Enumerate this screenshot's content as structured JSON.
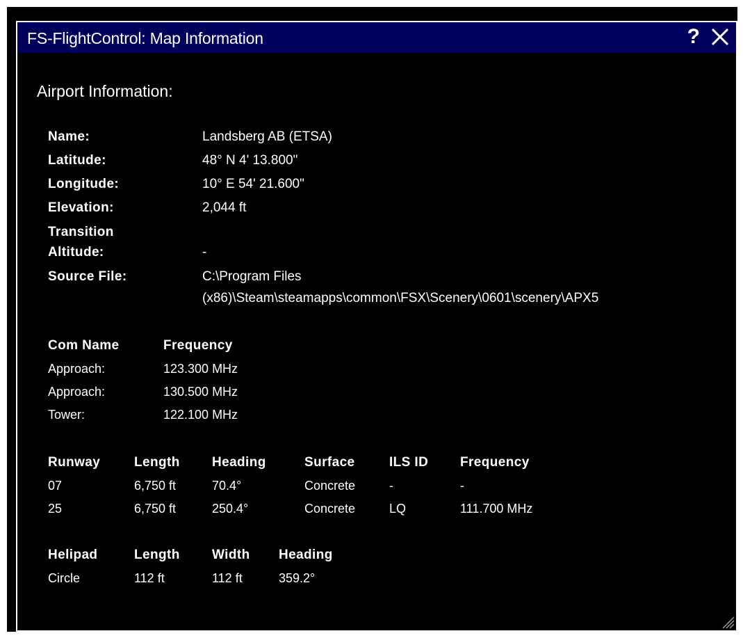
{
  "window": {
    "title": "FS-FlightControl: Map Information",
    "help_label": "?"
  },
  "section_title": "Airport Information:",
  "airport": {
    "name_label": "Name:",
    "name_value": "Landsberg AB (ETSA)",
    "latitude_label": "Latitude:",
    "latitude_value": "48° N 4' 13.800\"",
    "longitude_label": "Longitude:",
    "longitude_value": "10° E 54' 21.600\"",
    "elevation_label": "Elevation:",
    "elevation_value": "2,044 ft",
    "transition_label_1": "Transition",
    "transition_label_2": "Altitude:",
    "transition_value": "-",
    "source_label": "Source File:",
    "source_value_1": "C:\\Program Files",
    "source_value_2": "(x86)\\Steam\\steamapps\\common\\FSX\\Scenery\\0601\\scenery\\APX5"
  },
  "com": {
    "headers": [
      "Com Name",
      "Frequency"
    ],
    "rows": [
      [
        "Approach:",
        "123.300 MHz"
      ],
      [
        "Approach:",
        "130.500 MHz"
      ],
      [
        "Tower:",
        "122.100 MHz"
      ]
    ]
  },
  "runways": {
    "headers": [
      "Runway",
      "Length",
      "Heading",
      "Surface",
      "ILS ID",
      "Frequency"
    ],
    "rows": [
      [
        "07",
        "6,750 ft",
        "70.4°",
        "Concrete",
        "-",
        "-"
      ],
      [
        "25",
        "6,750 ft",
        "250.4°",
        "Concrete",
        "LQ",
        "111.700 MHz"
      ]
    ]
  },
  "helipads": {
    "headers": [
      "Helipad",
      "Length",
      "Width",
      "Heading"
    ],
    "rows": [
      [
        "Circle",
        "112 ft",
        "112 ft",
        "359.2°"
      ]
    ]
  },
  "colors": {
    "titlebar": "#00005c",
    "background": "#000000",
    "text": "#ffffff"
  },
  "icons": {
    "help": "help-icon",
    "close": "close-icon",
    "resize": "resize-grip-icon"
  }
}
